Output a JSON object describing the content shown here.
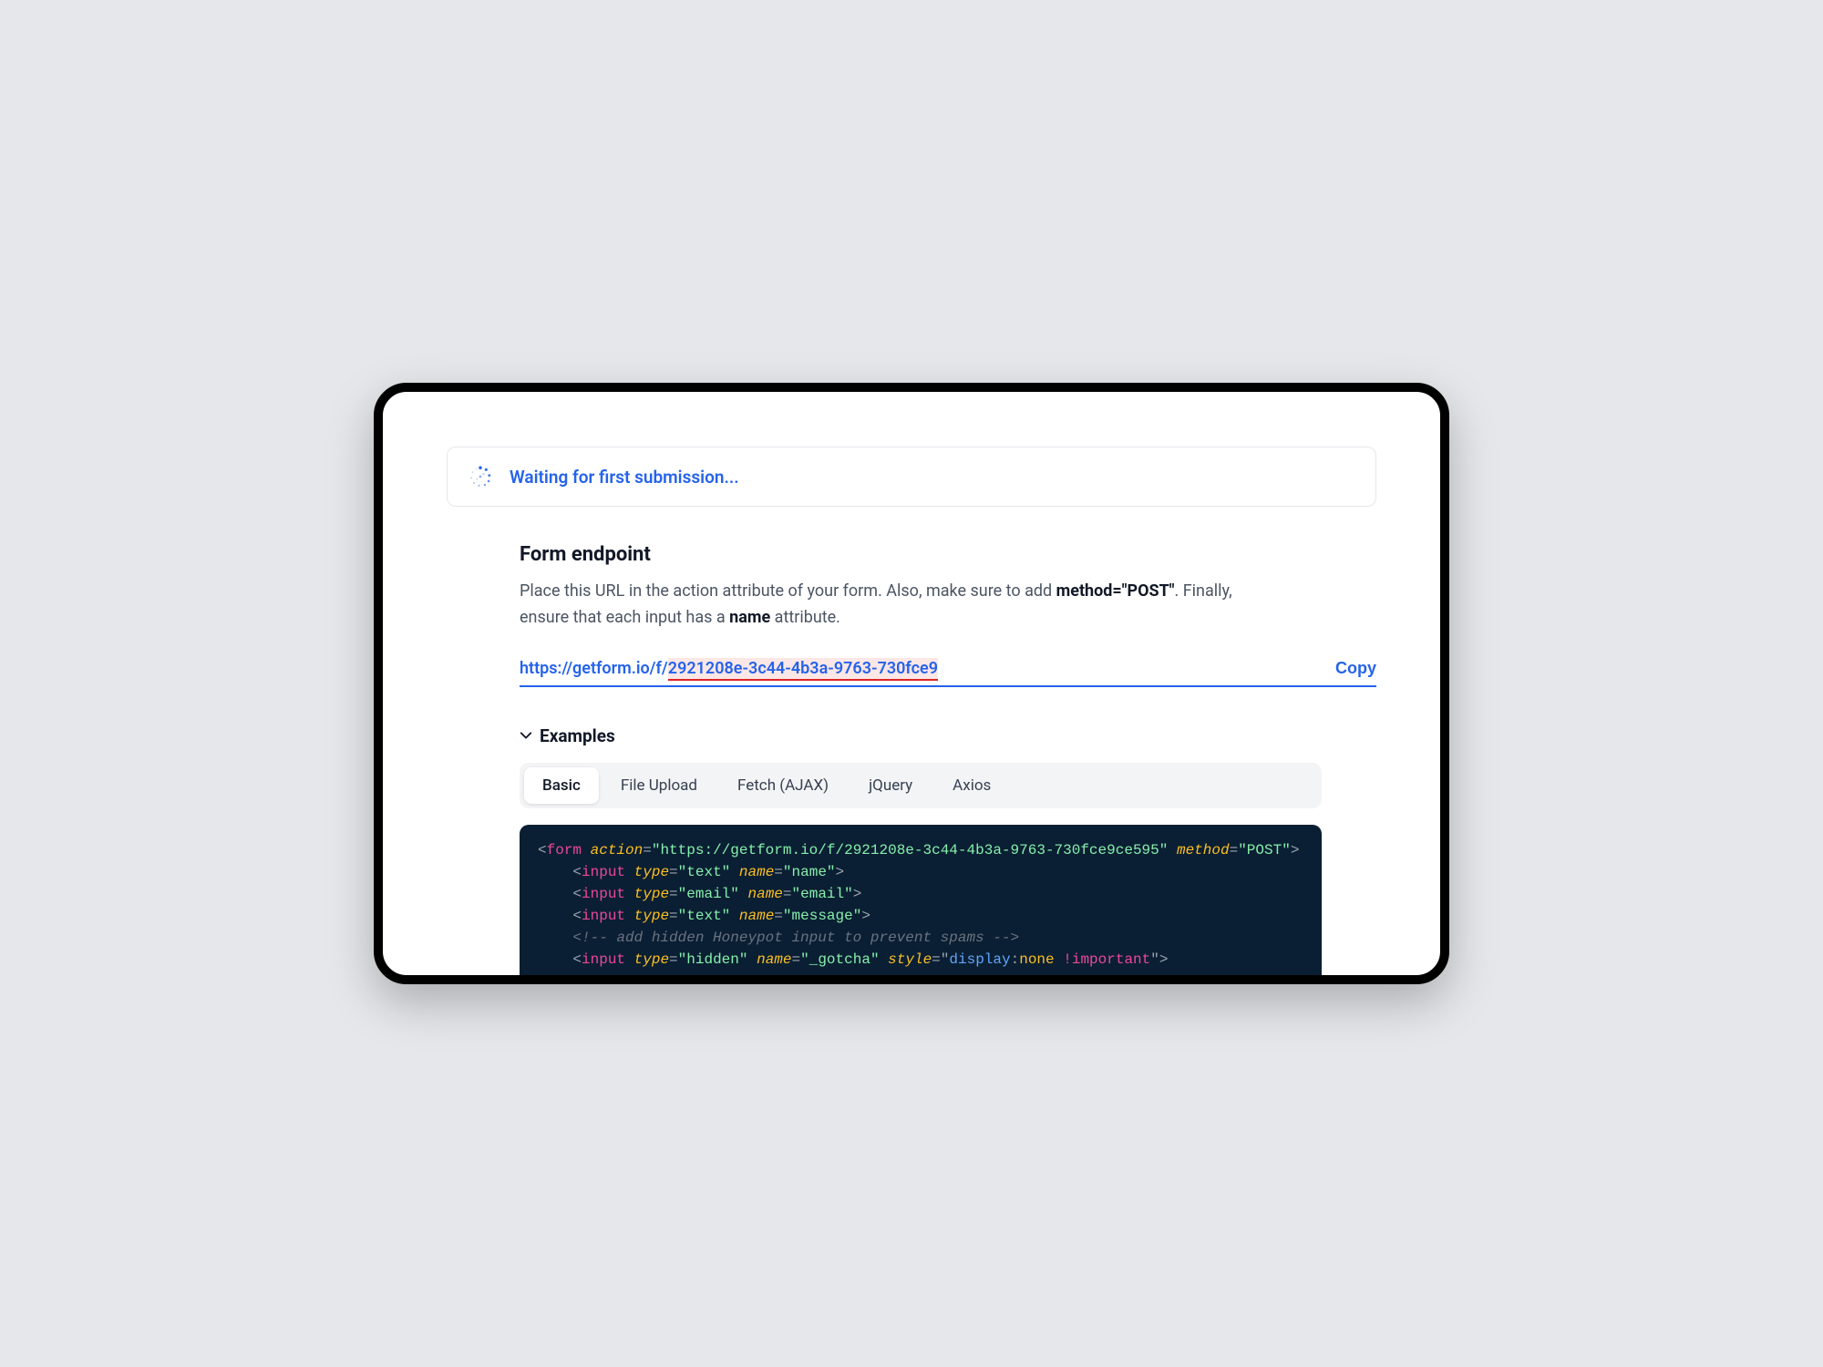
{
  "status": {
    "message": "Waiting for first submission..."
  },
  "section": {
    "title": "Form endpoint",
    "description_pre": "Place this URL in the action attribute of your form. Also, make sure to add ",
    "description_bold1": "method=\"POST\"",
    "description_mid": ". Finally, ensure that each input has a ",
    "description_bold2": "name",
    "description_post": " attribute."
  },
  "endpoint": {
    "base": "https://getform.io/f/",
    "id": "2921208e-3c44-4b3a-9763-730fce9",
    "copy_label": "Copy"
  },
  "examples": {
    "title": "Examples",
    "tabs": [
      {
        "label": "Basic",
        "active": true
      },
      {
        "label": "File Upload",
        "active": false
      },
      {
        "label": "Fetch (AJAX)",
        "active": false
      },
      {
        "label": "jQuery",
        "active": false
      },
      {
        "label": "Axios",
        "active": false
      }
    ]
  },
  "code": {
    "form_action": "https://getform.io/f/2921208e-3c44-4b3a-9763-730fce9ce595",
    "form_method": "POST",
    "input1_type": "text",
    "input1_name": "name",
    "input2_type": "email",
    "input2_name": "email",
    "input3_type": "text",
    "input3_name": "message",
    "comment": "add hidden Honeypot input to prevent spams",
    "input4_type": "hidden",
    "input4_name": "_gotcha",
    "input4_style_prop": "display",
    "input4_style_val": "none",
    "input4_style_imp": "!important"
  }
}
